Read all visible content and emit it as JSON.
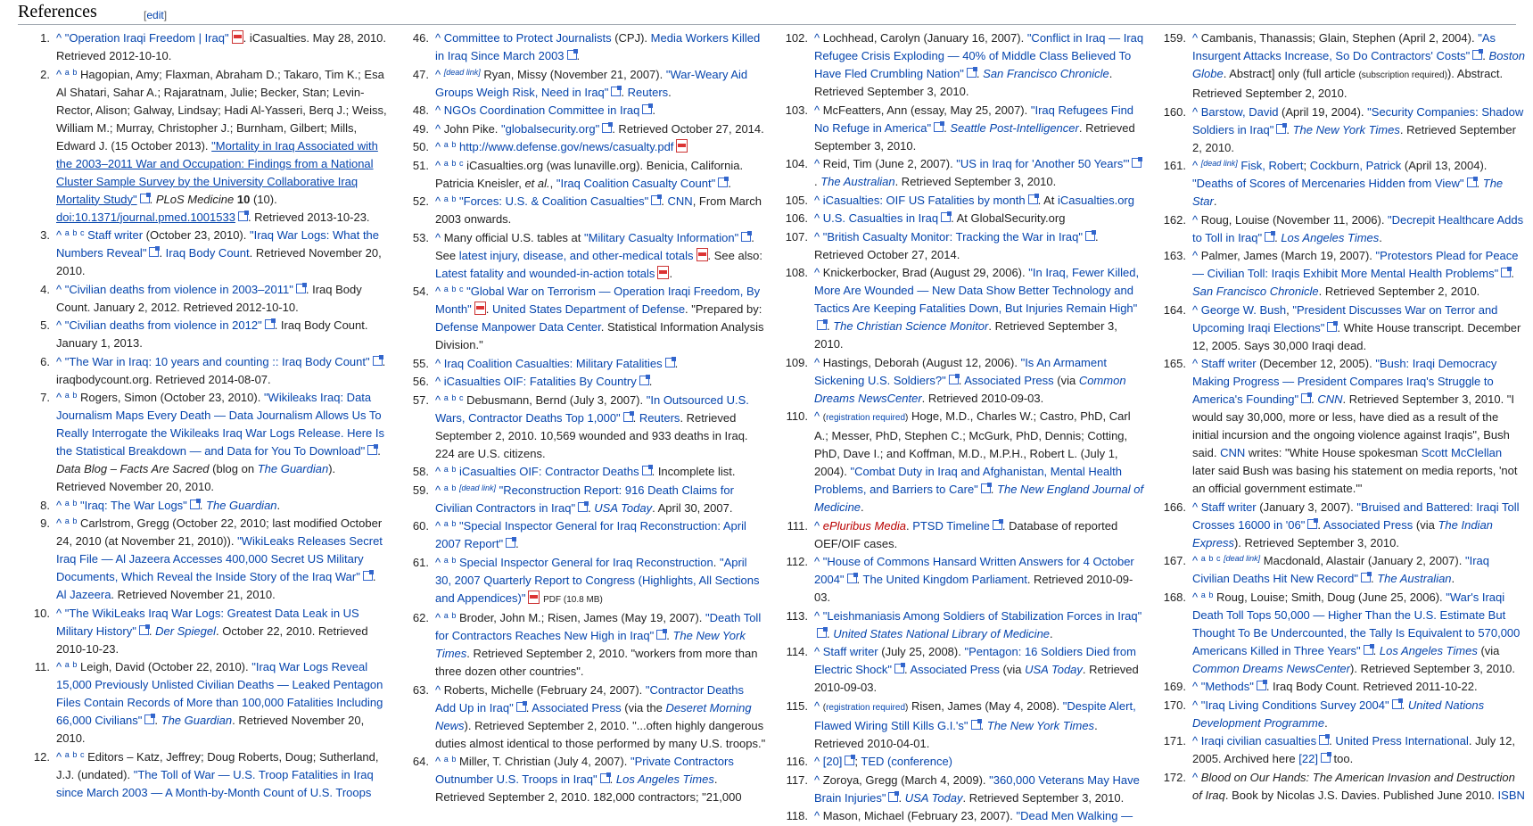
{
  "header": {
    "title": "References",
    "edit_label": "[edit]"
  },
  "columns": [
    [
      {
        "n": "1.",
        "html": "<span class='caret'>^</span> <a>\"Operation Iraqi Freedom | Iraq\"</a><span class='pdf' data-name='pdf-icon'></span>. iCasualties. May 28, 2010. Retrieved 2012-10-10."
      },
      {
        "n": "2.",
        "html": "<span class='caret'>^</span> <sup class='link'>a</sup> <sup class='link'>b</sup> Hagopian, Amy; Flaxman, Abraham D.; Takaro, Tim K.; Esa Al Shatari, Sahar A.; Rajaratnam, Julie; Becker, Stan; Levin-Rector, Alison; Galway, Lindsay; Hadi Al-Yasseri, Berq J.; Weiss, William M.; Murray, Christopher J.; Burnham, Gilbert; Mills, Edward J. (15 October 2013). <a class='u'>\"Mortality in Iraq Associated with the 2003–2011 War and Occupation: Findings from a National Cluster Sample Survey by the University Collaborative Iraq Mortality Study\"</a><span class='ext'></span>. <i>PLoS Medicine</i> <b>10</b> (10). <a class='u'>doi:10.1371/journal.pmed.1001533</a><span class='ext'></span>. Retrieved 2013-10-23."
      },
      {
        "n": "3.",
        "html": "<span class='caret'>^</span> <sup class='link'>a</sup> <sup class='link'>b</sup> <sup class='link'>c</sup> <a>Staff writer</a> (October 23, 2010). <a>\"Iraq War Logs: What the Numbers Reveal\"</a><span class='ext'></span>. <a>Iraq Body Count</a>. Retrieved November 20, 2010."
      },
      {
        "n": "4.",
        "html": "<span class='caret'>^</span> <a>\"Civilian deaths from violence in 2003–2011\"</a><span class='ext'></span>. Iraq Body Count. January 2, 2012. Retrieved 2012-10-10."
      },
      {
        "n": "5.",
        "html": "<span class='caret'>^</span> <a>\"Civilian deaths from violence in 2012\"</a><span class='ext'></span>. Iraq Body Count. January 1, 2013."
      },
      {
        "n": "6.",
        "html": "<span class='caret'>^</span> <a>\"The War in Iraq: 10 years and counting :: Iraq Body Count\"</a><span class='ext'></span>. iraqbodycount.org. Retrieved 2014-08-07."
      },
      {
        "n": "7.",
        "html": "<span class='caret'>^</span> <sup class='link'>a</sup> <sup class='link'>b</sup> Rogers, Simon (October 23, 2010). <a>\"Wikileaks Iraq: Data Journalism Maps Every Death — Data Journalism Allows Us To Really Interrogate the Wikileaks Iraq War Logs Release. Here Is the Statistical Breakdown — and Data for You To Download\"</a><span class='ext'></span>. <i>Data Blog – Facts Are Sacred</i> (blog on <a><i>The Guardian</i></a>). Retrieved November 20, 2010."
      },
      {
        "n": "8.",
        "html": "<span class='caret'>^</span> <sup class='link'>a</sup> <sup class='link'>b</sup> <a>\"Iraq: The War Logs\"</a><span class='ext'></span>. <a><i>The Guardian</i></a>."
      },
      {
        "n": "9.",
        "html": "<span class='caret'>^</span> <sup class='link'>a</sup> <sup class='link'>b</sup> Carlstrom, Gregg (October 22, 2010; last modified October 24, 2010 (at November 21, 2010)). <a>\"WikiLeaks Releases Secret Iraq File — Al Jazeera Accesses 400,000 Secret US Military Documents, Which Reveal the Inside Story of the Iraq War\"</a><span class='ext'></span>. <a>Al Jazeera</a>. Retrieved November 21, 2010."
      },
      {
        "n": "10.",
        "html": "<span class='caret'>^</span> <a>\"The WikiLeaks Iraq War Logs: Greatest Data Leak in US Military History\"</a><span class='ext'></span>. <a><i>Der Spiegel</i></a>. October 22, 2010. Retrieved 2010-10-23."
      },
      {
        "n": "11.",
        "html": "<span class='caret'>^</span> <sup class='link'>a</sup> <sup class='link'>b</sup> Leigh, David (October 22, 2010). <a>\"Iraq War Logs Reveal 15,000 Previously Unlisted Civilian Deaths — Leaked Pentagon Files Contain Records of More than 100,000 Fatalities Including 66,000 Civilians\"</a><span class='ext'></span>. <a><i>The Guardian</i></a>. Retrieved November 20, 2010."
      },
      {
        "n": "12.",
        "html": "<span class='caret'>^</span> <sup class='link'>a</sup> <sup class='link'>b</sup> <sup class='link'>c</sup> Editors – Katz, Jeffrey; Doug Roberts, Doug; Sutherland, J.J. (undated). <a>\"The Toll of War — U.S. Troop Fatalities in Iraq since March 2003 — A Month-by-Month Count of U.S. Troops</a>"
      }
    ],
    [
      {
        "n": "46.",
        "html": "<span class='caret'>^</span> <a>Committee to Protect Journalists</a> (CPJ). <a>Media Workers Killed in Iraq Since March 2003</a><span class='ext'></span>."
      },
      {
        "n": "47.",
        "html": "<span class='caret'>^</span> <sup><i class='link'>[dead link]</i></sup> Ryan, Missy (November 21, 2007). <a>\"War-Weary Aid Groups Weigh Risk, Need in Iraq\"</a><span class='ext'></span>. <a>Reuters</a>."
      },
      {
        "n": "48.",
        "html": "<span class='caret'>^</span> <a>NGOs Coordination Committee in Iraq</a><span class='ext'></span>."
      },
      {
        "n": "49.",
        "html": "<span class='caret'>^</span> John Pike. <a>\"globalsecurity.org\"</a><span class='ext'></span>. Retrieved October 27, 2014."
      },
      {
        "n": "50.",
        "html": "<span class='caret'>^</span> <sup class='link'>a</sup> <sup class='link'>b</sup> <a>http://www.defense.gov/news/casualty.pdf</a><span class='pdf' data-name='pdf-icon'></span>"
      },
      {
        "n": "51.",
        "html": "<span class='caret'>^</span> <sup class='link'>a</sup> <sup class='link'>b</sup> <sup class='link'>c</sup> iCasualties.org (was lunaville.org). Benicia, California. Patricia Kneisler, <i>et al.</i>, <a>\"Iraq Coalition Casualty Count\"</a><span class='ext'></span>."
      },
      {
        "n": "52.",
        "html": "<span class='caret'>^</span> <sup class='link'>a</sup> <sup class='link'>b</sup> <a>\"Forces: U.S. &amp; Coalition Casualties\"</a><span class='ext'></span>. <a>CNN</a>, From March 2003 onwards."
      },
      {
        "n": "53.",
        "html": "<span class='caret'>^</span> Many official U.S. tables at <a>\"Military Casualty Information\"</a><span class='ext'></span>. See <a>latest injury, disease, and other-medical totals</a><span class='pdf' data-name='pdf-icon'></span>. See also: <a>Latest fatality and wounded-in-action totals</a><span class='pdf' data-name='pdf-icon'></span>."
      },
      {
        "n": "54.",
        "html": "<span class='caret'>^</span> <sup class='link'>a</sup> <sup class='link'>b</sup> <sup class='link'>c</sup> <a>\"Global War on Terrorism — Operation Iraqi Freedom, By Month\"</a><span class='pdf' data-name='pdf-icon'></span>. <a>United States Department of Defense</a>. \"Prepared by: <a>Defense Manpower Data Center</a>. Statistical Information Analysis Division.\""
      },
      {
        "n": "55.",
        "html": "<span class='caret'>^</span> <a>Iraq Coalition Casualties: Military Fatalities</a><span class='ext'></span>."
      },
      {
        "n": "56.",
        "html": "<span class='caret'>^</span> <a>iCasualties OIF: Fatalities By Country</a><span class='ext'></span>."
      },
      {
        "n": "57.",
        "html": "<span class='caret'>^</span> <sup class='link'>a</sup> <sup class='link'>b</sup> <sup class='link'>c</sup> Debusmann, Bernd (July 3, 2007). <a>\"In Outsourced U.S. Wars, Contractor Deaths Top 1,000\"</a><span class='ext'></span>. <a>Reuters</a>. Retrieved September 2, 2010. 10,569 wounded and 933 deaths in Iraq. 224 are U.S. citizens."
      },
      {
        "n": "58.",
        "html": "<span class='caret'>^</span> <sup class='link'>a</sup> <sup class='link'>b</sup> <a>iCasualties OIF: Contractor Deaths</a><span class='ext'></span>. Incomplete list."
      },
      {
        "n": "59.",
        "html": "<span class='caret'>^</span> <sup class='link'>a</sup> <sup class='link'>b</sup> <sup><i class='link'>[dead link]</i></sup> <a>\"Reconstruction Report: 916 Death Claims for Civilian Contractors in Iraq\"</a><span class='ext'></span>. <a><i>USA Today</i></a>. April 30, 2007."
      },
      {
        "n": "60.",
        "html": "<span class='caret'>^</span> <sup class='link'>a</sup> <sup class='link'>b</sup> <a>\"Special Inspector General for Iraq Reconstruction: April 2007 Report\"</a><span class='ext'></span>."
      },
      {
        "n": "61.",
        "html": "<span class='caret'>^</span> <sup class='link'>a</sup> <sup class='link'>b</sup> <a>Special Inspector General for Iraq Reconstruction</a>. <a>\"April 30, 2007 Quarterly Report to Congress (Highlights, All Sections and Appendices)\"</a><span class='pdf' data-name='pdf-icon'></span> <span class='small'>PDF (10.8 MB)</span>"
      },
      {
        "n": "62.",
        "html": "<span class='caret'>^</span> <sup class='link'>a</sup> <sup class='link'>b</sup> Broder, John M.; Risen, James (May 19, 2007). <a>\"Death Toll for Contractors Reaches New High in Iraq\"</a><span class='ext'></span>. <a><i>The New York Times</i></a>. Retrieved September 2, 2010. \"workers from more than three dozen other countries\"."
      },
      {
        "n": "63.",
        "html": "<span class='caret'>^</span> Roberts, Michelle (February 24, 2007). <a>\"Contractor Deaths Add Up in Iraq\"</a><span class='ext'></span>. <a>Associated Press</a> (via the <a><i>Deseret Morning News</i></a>). Retrieved September 2, 2010. \"...often highly dangerous duties almost identical to those performed by many U.S. troops.\""
      },
      {
        "n": "64.",
        "html": "<span class='caret'>^</span> <sup class='link'>a</sup> <sup class='link'>b</sup> Miller, T. Christian (July 4, 2007). <a>\"Private Contractors Outnumber U.S. Troops in Iraq\"</a><span class='ext'></span>. <a><i>Los Angeles Times</i></a>. Retrieved September 2, 2010. 182,000 contractors; \"21,000"
      }
    ],
    [
      {
        "n": "102.",
        "html": "<span class='caret'>^</span> Lochhead, Carolyn (January 16, 2007). <a>\"Conflict in Iraq — Iraq Refugee Crisis Exploding — 40% of Middle Class Believed To Have Fled Crumbling Nation\"</a><span class='ext'></span>. <a><i>San Francisco Chronicle</i></a>. Retrieved September 3, 2010."
      },
      {
        "n": "103.",
        "html": "<span class='caret'>^</span> McFeatters, Ann (essay, May 25, 2007). <a>\"Iraq Refugees Find No Refuge in America\"</a><span class='ext'></span>. <a><i>Seattle Post-Intelligencer</i></a>. Retrieved September 3, 2010."
      },
      {
        "n": "104.",
        "html": "<span class='caret'>^</span> Reid, Tim (June 2, 2007). <a>\"US in Iraq for 'Another 50 Years'\"</a><span class='ext'></span>. <a><i>The Australian</i></a>. Retrieved September 3, 2010."
      },
      {
        "n": "105.",
        "html": "<span class='caret'>^</span> <a>iCasualties: OIF US Fatalities by month</a><span class='ext'></span>. At <a>iCasualties.org</a>"
      },
      {
        "n": "106.",
        "html": "<span class='caret'>^</span> <a>U.S. Casualties in Iraq</a><span class='ext'></span>. At GlobalSecurity.org"
      },
      {
        "n": "107.",
        "html": "<span class='caret'>^</span> <a>\"British Casualty Monitor: Tracking the War in Iraq\"</a><span class='ext'></span>. Retrieved October 27, 2014."
      },
      {
        "n": "108.",
        "html": "<span class='caret'>^</span> Knickerbocker, Brad (August 29, 2006). <a>\"In Iraq, Fewer Killed, More Are Wounded — New Data Show Better Technology and Tactics Are Keeping Fatalities Down, But Injuries Remain High\"</a><span class='ext'></span>. <a><i>The Christian Science Monitor</i></a>. Retrieved September 3, 2010."
      },
      {
        "n": "109.",
        "html": "<span class='caret'>^</span> Hastings, Deborah (August 12, 2006). <a>\"Is An Armament Sickening U.S. Soldiers?\"</a><span class='ext'></span>. <a>Associated Press</a> (via <a><i>Common Dreams NewsCenter</i></a>. Retrieved 2010-09-03."
      },
      {
        "n": "110.",
        "html": "<span class='caret'>^</span> <span class='small'>(<a>registration required</a>)</span> Hoge, M.D., Charles W.; Castro, PhD, Carl A.; Messer, PhD, Stephen C.; McGurk, PhD, Dennis; Cotting, PhD, Dave I.; and Koffman, M.D., M.P.H., Robert L. (July 1, 2004). <a>\"Combat Duty in Iraq and Afghanistan, Mental Health Problems, and Barriers to Care\"</a><span class='ext'></span>. <a><i>The New England Journal of Medicine</i></a>."
      },
      {
        "n": "111.",
        "html": "<span class='caret'>^</span> <i class='red'>ePluribus Media</i>. <a>PTSD Timeline</a><span class='ext'></span>. Database of reported OEF/OIF cases."
      },
      {
        "n": "112.",
        "html": "<span class='caret'>^</span> <a>\"House of Commons Hansard Written Answers for 4 October 2004\"</a><span class='ext'></span>. <a>The United Kingdom Parliament</a>. Retrieved 2010-09-03."
      },
      {
        "n": "113.",
        "html": "<span class='caret'>^</span> <a>\"Leishmaniasis Among Soldiers of Stabilization Forces in Iraq\"</a><span class='ext'></span>. <a><i>United States National Library of Medicine</i></a>."
      },
      {
        "n": "114.",
        "html": "<span class='caret'>^</span> <a>Staff writer</a> (July 25, 2008). <a>\"Pentagon: 16 Soldiers Died from Electric Shock\"</a><span class='ext'></span>. <a>Associated Press</a> (via <a><i>USA Today</i></a>. Retrieved 2010-09-03."
      },
      {
        "n": "115.",
        "html": "<span class='caret'>^</span> <span class='small'>(<a>registration required</a>)</span> Risen, James (May 4, 2008). <a>\"Despite Alert, Flawed Wiring Still Kills G.I.'s\"</a><span class='ext'></span>. <a><i>The New York Times</i></a>. Retrieved 2010-04-01."
      },
      {
        "n": "116.",
        "html": "<span class='caret'>^</span> <a>[20]</a><span class='ext'></span>; <a>TED (conference)</a>"
      },
      {
        "n": "117.",
        "html": "<span class='caret'>^</span> Zoroya, Gregg (March 4, 2009). <a>\"360,000 Veterans May Have Brain Injuries\"</a><span class='ext'></span>. <a><i>USA Today</i></a>. Retrieved September 3, 2010."
      },
      {
        "n": "118.",
        "html": "<span class='caret'>^</span> Mason, Michael (February 23, 2007). <a>\"Dead Men Walking —</a>"
      }
    ],
    [
      {
        "n": "159.",
        "html": "<span class='caret'>^</span> Cambanis, Thanassis; Glain, Stephen (April 2, 2004). <a>\"As Insurgent Attacks Increase, So Do Contractors' Costs\"</a><span class='ext'></span>. <a><i>Boston Globe</i></a>. Abstract] only (full article <span class='small'>(subscription required)</span>). Abstract. Retrieved September 2, 2010."
      },
      {
        "n": "160.",
        "html": "<span class='caret'>^</span> <a>Barstow, David</a> (April 19, 2004). <a>\"Security Companies: Shadow Soldiers in Iraq\"</a><span class='ext'></span>. <a><i>The New York Times</i></a>. Retrieved September 2, 2010."
      },
      {
        "n": "161.",
        "html": "<span class='caret'>^</span> <sup><i class='link'>[dead link]</i></sup> <a>Fisk, Robert</a>; <a>Cockburn, Patrick</a> (April 13, 2004). <a>\"Deaths of Scores of Mercenaries Hidden from View\"</a><span class='ext'></span>. <a><i>The Star</i></a>."
      },
      {
        "n": "162.",
        "html": "<span class='caret'>^</span> Roug, Louise (November 11, 2006). <a>\"Decrepit Healthcare Adds to Toll in Iraq\"</a><span class='ext'></span>. <a><i>Los Angeles Times</i></a>."
      },
      {
        "n": "163.",
        "html": "<span class='caret'>^</span> Palmer, James (March 19, 2007). <a>\"Protestors Plead for Peace — Civilian Toll: Iraqis Exhibit More Mental Health Problems\"</a><span class='ext'></span>. <a><i>San Francisco Chronicle</i></a>. Retrieved September 2, 2010."
      },
      {
        "n": "164.",
        "html": "<span class='caret'>^</span> <a>George W. Bush</a>, <a>\"President Discusses War on Terror and Upcoming Iraqi Elections\"</a><span class='ext'></span>. White House transcript. December 12, 2005. Says 30,000 Iraqi dead."
      },
      {
        "n": "165.",
        "html": "<span class='caret'>^</span> <a>Staff writer</a> (December 12, 2005). <a>\"Bush: Iraqi Democracy Making Progress — President Compares Iraq's Struggle to America's Founding\"</a><span class='ext'></span>. <a><i>CNN</i></a>. Retrieved September 3, 2010. \"I would say 30,000, more or less, have died as a result of the initial incursion and the ongoing violence against Iraqis\", Bush said. <a>CNN</a> writes: \"White House spokesman <a>Scott McClellan</a> later said Bush was basing his statement on media reports, 'not an official government estimate.'\""
      },
      {
        "n": "166.",
        "html": "<span class='caret'>^</span> <a>Staff writer</a> (January 3, 2007). <a>\"Bruised and Battered: Iraqi Toll Crosses 16000 in '06\"</a><span class='ext'></span>. <a>Associated Press</a> (via <a><i>The Indian Express</i></a>). Retrieved September 3, 2010."
      },
      {
        "n": "167.",
        "html": "<span class='caret'>^</span> <sup class='link'>a</sup> <sup class='link'>b</sup> <sup class='link'>c</sup> <sup><i class='link'>[dead link]</i></sup> Macdonald, Alastair (January 2, 2007). <a>\"Iraq Civilian Deaths Hit New Record\"</a><span class='ext'></span>. <a><i>The Australian</i></a>."
      },
      {
        "n": "168.",
        "html": "<span class='caret'>^</span> <sup class='link'>a</sup> <sup class='link'>b</sup> Roug, Louise; Smith, Doug (June 25, 2006). <a>\"War's Iraqi Death Toll Tops 50,000 — Higher Than the U.S. Estimate But Thought To Be Undercounted, the Tally Is Equivalent to 570,000 Americans Killed in Three Years\"</a><span class='ext'></span>. <a><i>Los Angeles Times</i></a> (via <a><i>Common Dreams NewsCenter</i></a>). Retrieved September 3, 2010."
      },
      {
        "n": "169.",
        "html": "<span class='caret'>^</span> <a>\"Methods\"</a><span class='ext'></span>. Iraq Body Count. Retrieved 2011-10-22."
      },
      {
        "n": "170.",
        "html": "<span class='caret'>^</span> <a>\"Iraq Living Conditions Survey 2004\"</a><span class='ext'></span>. <a><i>United Nations Development Programme</i></a>."
      },
      {
        "n": "171.",
        "html": "<span class='caret'>^</span> <a>Iraqi civilian casualties</a><span class='ext'></span>. <a>United Press International</a>. July 12, 2005. Archived here <a>[22]</a><span class='ext'></span> too."
      },
      {
        "n": "172.",
        "html": "<span class='caret'>^</span> <i>Blood on Our Hands: The American Invasion and Destruction of Iraq</i>. Book by Nicolas J.S. Davies. Published June 2010. <a>ISBN</a>"
      }
    ]
  ]
}
